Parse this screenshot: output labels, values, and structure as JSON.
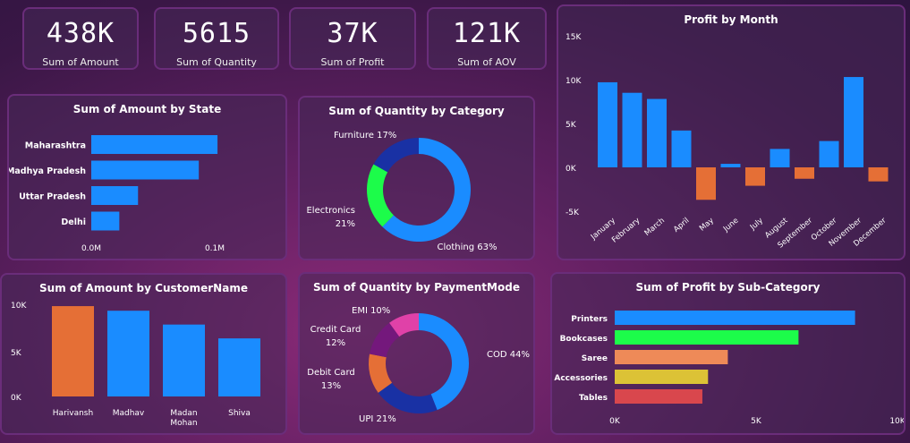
{
  "kpis": [
    {
      "value": "438K",
      "label": "Sum of Amount"
    },
    {
      "value": "5615",
      "label": "Sum of Quantity"
    },
    {
      "value": "37K",
      "label": "Sum of Profit"
    },
    {
      "value": "121K",
      "label": "Sum of AOV"
    }
  ],
  "colors": {
    "blue": "#1a8cff",
    "orange": "#e56f36",
    "green": "#1cfc4a",
    "salmon": "#ee8a58",
    "yellow": "#dcc236",
    "red": "#d9474d",
    "navy": "#1931a4",
    "purple": "#74187c",
    "pink": "#e041a8"
  },
  "chart_data": [
    {
      "id": "state",
      "type": "bar",
      "orientation": "horizontal",
      "title": "Sum of Amount by State",
      "categories": [
        "Maharashtra",
        "Madhya Pradesh",
        "Uttar Pradesh",
        "Delhi"
      ],
      "values": [
        0.135,
        0.115,
        0.05,
        0.03
      ],
      "ticks": [
        "0.0M",
        "0.1M"
      ],
      "xlim": [
        0,
        0.2
      ]
    },
    {
      "id": "category",
      "type": "pie",
      "donut": true,
      "title": "Sum of Quantity by Category",
      "labels": [
        "Clothing",
        "Electronics",
        "Furniture"
      ],
      "values": [
        63,
        21,
        17
      ],
      "display": [
        "Clothing 63%",
        "Electronics",
        "21%",
        "Furniture 17%"
      ]
    },
    {
      "id": "month",
      "type": "bar",
      "title": "Profit by Month",
      "categories": [
        "January",
        "February",
        "March",
        "April",
        "May",
        "June",
        "July",
        "August",
        "September",
        "October",
        "November",
        "December"
      ],
      "values": [
        9700,
        8500,
        7800,
        4200,
        -3700,
        400,
        -2100,
        2100,
        -1300,
        3000,
        10300,
        -1600
      ],
      "yticks": [
        "15K",
        "10K",
        "5K",
        "0K",
        "-5K"
      ],
      "ylim": [
        -5000,
        15000
      ]
    },
    {
      "id": "customer",
      "type": "bar",
      "title": "Sum of Amount by CustomerName",
      "categories": [
        "Harivansh",
        "Madhav",
        "Madan Mohan",
        "Shiva"
      ],
      "values": [
        9800,
        9300,
        7800,
        6300
      ],
      "yticks": [
        "10K",
        "5K",
        "0K"
      ],
      "ylim": [
        0,
        10000
      ]
    },
    {
      "id": "payment",
      "type": "pie",
      "donut": true,
      "title": "Sum of Quantity by PaymentMode",
      "labels": [
        "COD",
        "UPI",
        "Debit Card",
        "Credit Card",
        "EMI"
      ],
      "values": [
        44,
        21,
        13,
        12,
        10
      ],
      "display": [
        "COD 44%",
        "UPI 21%",
        "Debit Card",
        "13%",
        "Credit Card",
        "12%",
        "EMI 10%"
      ]
    },
    {
      "id": "subcat",
      "type": "bar",
      "orientation": "horizontal",
      "title": "Sum of Profit by Sub-Category",
      "categories": [
        "Printers",
        "Bookcases",
        "Saree",
        "Accessories",
        "Tables"
      ],
      "values": [
        8500,
        6500,
        4000,
        3300,
        3100
      ],
      "ticks": [
        "0K",
        "5K",
        "10K"
      ],
      "xlim": [
        0,
        10000
      ]
    }
  ]
}
